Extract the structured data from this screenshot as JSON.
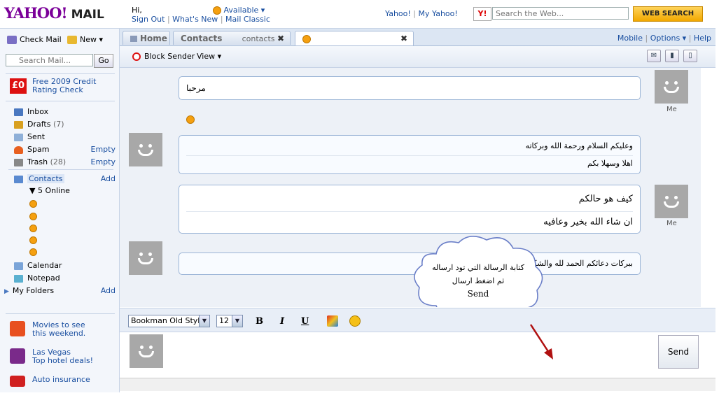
{
  "header": {
    "logo_yahoo": "YAHOO!",
    "logo_mail": "MAIL",
    "greeting": "Hi,",
    "status": "Available ▾",
    "sign_out": "Sign Out",
    "whats_new": "What's New",
    "mail_classic": "Mail Classic",
    "yahoo_link": "Yahoo!",
    "my_yahoo_link": "My Yahoo!",
    "y_badge": "Y!",
    "search_placeholder": "Search the Web...",
    "web_search_label": "WEB SEARCH"
  },
  "sidebar": {
    "check_mail": "Check Mail",
    "new_label": "New ▾",
    "search_placeholder": "Search Mail...",
    "go_label": "Go",
    "credit_badge": "£0",
    "credit_text_1": "Free 2009 Credit",
    "credit_text_2": "Rating Check",
    "folders": [
      {
        "label": "Inbox",
        "count": "",
        "action": ""
      },
      {
        "label": "Drafts",
        "count": "(7)",
        "action": ""
      },
      {
        "label": "Sent",
        "count": "",
        "action": ""
      },
      {
        "label": "Spam",
        "count": "",
        "action": "Empty"
      },
      {
        "label": "Trash",
        "count": "(28)",
        "action": "Empty"
      },
      {
        "label": "Contacts",
        "count": "",
        "action": "Add"
      }
    ],
    "online_label": "▼ 5 Online",
    "calendar": "Calendar",
    "notepad": "Notepad",
    "my_folders": "My Folders",
    "my_folders_add": "Add",
    "ads": [
      {
        "line1": "Movies to see",
        "line2": "this weekend."
      },
      {
        "line1": "Las Vegas",
        "line2": "Top hotel deals!"
      },
      {
        "line1": "Auto insurance",
        "line2": ""
      }
    ]
  },
  "tabs": {
    "home": "Home",
    "contacts": "Contacts",
    "contacts_suffix": "contacts",
    "close": "✖",
    "mobile": "Mobile",
    "options": "Options ▾",
    "help": "Help"
  },
  "toolbar": {
    "block_sender": "Block Sender",
    "view": "View ▾"
  },
  "conversation": {
    "me_label": "Me",
    "messages": [
      {
        "lines": [
          "مرحبا"
        ]
      },
      {
        "lines": [
          "وعليكم السلام ورحمة الله وبركاته",
          "اهلا وسهلا بكم"
        ]
      },
      {
        "lines": [
          "كيف هو حالكم",
          "ان شاء الله بخير وعافيه"
        ]
      },
      {
        "lines": [
          "ببركات دعائكم الحمد لله والشكر له"
        ]
      }
    ],
    "callout_line1": "كتابة الرسالة التي تود ارساله",
    "callout_line2": "ثم اضغط ارسال",
    "callout_line3": "Send"
  },
  "composer": {
    "font_name": "Bookman Old Style",
    "font_size": "12",
    "bold": "B",
    "italic": "I",
    "underline": "U",
    "send_label": "Send"
  },
  "colors": {
    "accent": "#1a4fa0",
    "bubble_border": "#9ab4d6",
    "presence": "#f5a010",
    "arrow": "#b01010"
  }
}
